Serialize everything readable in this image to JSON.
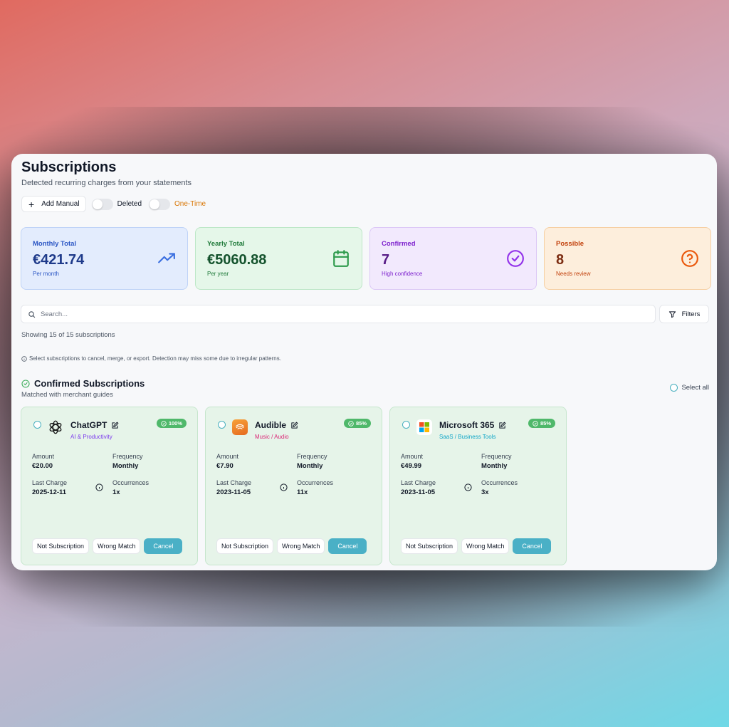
{
  "header": {
    "title": "Subscriptions",
    "subtitle": "Detected recurring charges from your statements"
  },
  "toolbar": {
    "add_manual_label": "Add Manual",
    "deleted_label": "Deleted",
    "deleted_on": false,
    "one_time_label": "One-Time",
    "one_time_on": false
  },
  "stats": {
    "monthly": {
      "label": "Monthly Total",
      "value": "€421.74",
      "sub": "Per month",
      "icon": "trending-up-icon"
    },
    "yearly": {
      "label": "Yearly Total",
      "value": "€5060.88",
      "sub": "Per year",
      "icon": "calendar-icon"
    },
    "confirmed": {
      "label": "Confirmed",
      "value": "7",
      "sub": "High confidence",
      "icon": "check-circle-icon"
    },
    "possible": {
      "label": "Possible",
      "value": "8",
      "sub": "Needs review",
      "icon": "question-circle-icon"
    }
  },
  "search": {
    "placeholder": "Search...",
    "value": ""
  },
  "filters_label": "Filters",
  "showing": "Showing 15 of 15 subscriptions",
  "hint": "Select subscriptions to cancel, merge, or export. Detection may miss some due to irregular patterns.",
  "section": {
    "title": "Confirmed Subscriptions",
    "subtitle": "Matched with merchant guides",
    "select_all": "Select all"
  },
  "colors": {
    "accent": "#4ab0c6",
    "badge": "#4fb86a",
    "card_bg": "#e6f4e9"
  },
  "field_labels": {
    "amount": "Amount",
    "frequency": "Frequency",
    "last_charge": "Last Charge",
    "occurrences": "Occurrences"
  },
  "card_actions": {
    "not_subscription": "Not Subscription",
    "wrong_match": "Wrong Match",
    "cancel": "Cancel"
  },
  "cards": [
    {
      "name": "ChatGPT",
      "category": "AI & Productivity",
      "category_color": "#7c3aed",
      "confidence": "100%",
      "amount": "€20.00",
      "frequency": "Monthly",
      "last_charge": "2025-12-11",
      "occurrences": "1x",
      "logo": "openai-logo-icon"
    },
    {
      "name": "Audible",
      "category": "Music / Audio",
      "category_color": "#db2777",
      "confidence": "85%",
      "amount": "€7.90",
      "frequency": "Monthly",
      "last_charge": "2023-11-05",
      "occurrences": "11x",
      "logo": "audible-logo-icon"
    },
    {
      "name": "Microsoft 365",
      "category": "SaaS / Business Tools",
      "category_color": "#0ea5c7",
      "confidence": "85%",
      "amount": "€49.99",
      "frequency": "Monthly",
      "last_charge": "2023-11-05",
      "occurrences": "3x",
      "logo": "microsoft-logo-icon"
    }
  ]
}
